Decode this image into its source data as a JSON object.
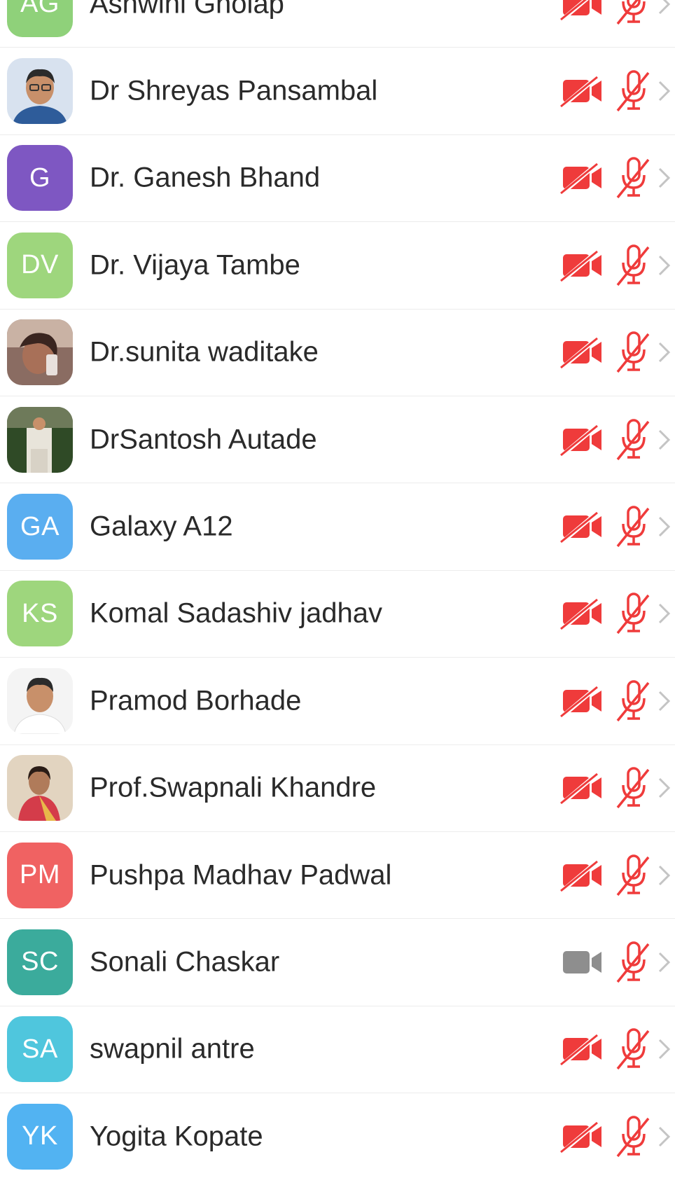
{
  "participants": [
    {
      "name": "Ashwini Gholap",
      "initials": "AG",
      "color": "#8fd17a",
      "photo": null,
      "video_on": false,
      "muted": true
    },
    {
      "name": "Dr Shreyas Pansambal",
      "initials": "",
      "color": "#c9d7ea",
      "photo": "photo-man-glasses",
      "video_on": false,
      "muted": true
    },
    {
      "name": "Dr. Ganesh Bhand",
      "initials": "G",
      "color": "#7e57c2",
      "photo": null,
      "video_on": false,
      "muted": true
    },
    {
      "name": "Dr. Vijaya Tambe",
      "initials": "DV",
      "color": "#9ed67d",
      "photo": null,
      "video_on": false,
      "muted": true
    },
    {
      "name": "Dr.sunita waditake",
      "initials": "",
      "color": "#7a5a50",
      "photo": "photo-woman-selfie",
      "video_on": false,
      "muted": true
    },
    {
      "name": "DrSantosh Autade",
      "initials": "",
      "color": "#3b5a2e",
      "photo": "photo-man-outdoor",
      "video_on": false,
      "muted": true
    },
    {
      "name": "Galaxy A12",
      "initials": "GA",
      "color": "#5aaef0",
      "photo": null,
      "video_on": false,
      "muted": true
    },
    {
      "name": "Komal Sadashiv jadhav",
      "initials": "KS",
      "color": "#9ed67d",
      "photo": null,
      "video_on": false,
      "muted": true
    },
    {
      "name": "Pramod Borhade",
      "initials": "",
      "color": "#f2f2f2",
      "photo": "photo-man-portrait",
      "video_on": false,
      "muted": true
    },
    {
      "name": "Prof.Swapnali Khandre",
      "initials": "",
      "color": "#d9c8b0",
      "photo": "photo-woman-saree",
      "video_on": false,
      "muted": true
    },
    {
      "name": "Pushpa Madhav Padwal",
      "initials": "PM",
      "color": "#f06262",
      "photo": null,
      "video_on": false,
      "muted": true
    },
    {
      "name": "Sonali Chaskar",
      "initials": "SC",
      "color": "#3bab9c",
      "photo": null,
      "video_on": true,
      "muted": true
    },
    {
      "name": "swapnil antre",
      "initials": "SA",
      "color": "#4fc6dd",
      "photo": null,
      "video_on": false,
      "muted": true
    },
    {
      "name": "Yogita Kopate",
      "initials": "YK",
      "color": "#52b3f2",
      "photo": null,
      "video_on": false,
      "muted": true
    }
  ],
  "colors": {
    "muted_red": "#ef3b3b",
    "video_gray": "#8e8e8e",
    "chevron_gray": "#c4c4c4",
    "text": "#2a2a2a",
    "divider": "#ececec"
  }
}
